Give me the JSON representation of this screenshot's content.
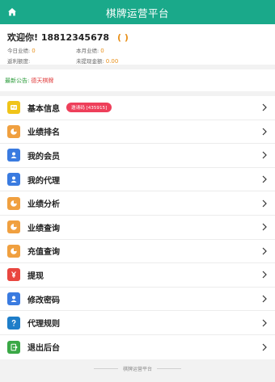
{
  "header": {
    "title": "棋牌运营平台",
    "home_icon": "home-icon"
  },
  "profile": {
    "welcome": "欢迎你! 18812345678",
    "paren": "( )",
    "today_label": "今日业绩:",
    "today_value": "0",
    "month_label": "本月业绩:",
    "month_value": "0",
    "rebate_label": "返利额度:",
    "rebate_value": "",
    "unwithdrawn_label": "未提现金额:",
    "unwithdrawn_value": "0.00"
  },
  "notice": {
    "label": "最新公告:",
    "text": "德天棋牌"
  },
  "menu": {
    "items": [
      {
        "label": "基本信息",
        "badge": "邀请码 [435915]",
        "icon": "info-card-icon",
        "color": "#f0c419"
      },
      {
        "label": "业绩排名",
        "icon": "ranking-icon",
        "color": "#f0a040"
      },
      {
        "label": "我的会员",
        "icon": "member-icon",
        "color": "#3a7be0"
      },
      {
        "label": "我的代理",
        "icon": "agent-icon",
        "color": "#3a7be0"
      },
      {
        "label": "业绩分析",
        "icon": "analysis-icon",
        "color": "#f0a040"
      },
      {
        "label": "业绩查询",
        "icon": "performance-query-icon",
        "color": "#f0a040"
      },
      {
        "label": "充值查询",
        "icon": "recharge-query-icon",
        "color": "#f0a040"
      },
      {
        "label": "提现",
        "icon": "withdraw-icon",
        "color": "#e9463f"
      },
      {
        "label": "修改密码",
        "icon": "password-icon",
        "color": "#3a7be0"
      },
      {
        "label": "代理规则",
        "icon": "help-icon",
        "color": "#1e7ec9"
      },
      {
        "label": "退出后台",
        "icon": "logout-icon",
        "color": "#3aa846"
      }
    ]
  },
  "footer": {
    "text": "棋牌运营平台"
  }
}
